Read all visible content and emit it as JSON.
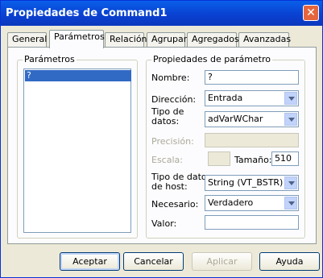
{
  "window": {
    "title": "Propiedades de Command1",
    "close_symbol": "✕"
  },
  "tabs": [
    {
      "label": "General"
    },
    {
      "label": "Parámetros"
    },
    {
      "label": "Relación"
    },
    {
      "label": "Agrupar"
    },
    {
      "label": "Agregados"
    },
    {
      "label": "Avanzadas"
    }
  ],
  "params_group": {
    "title": "Parámetros",
    "items": [
      "?"
    ]
  },
  "props_group": {
    "title": "Propiedades de parámetro"
  },
  "fields": {
    "nombre": {
      "label": "Nombre:",
      "value": "?"
    },
    "direccion": {
      "label": "Dirección:",
      "value": "Entrada"
    },
    "tipo_datos": {
      "label_line1": "Tipo de",
      "label_line2": "datos:",
      "value": "adVarWChar"
    },
    "precision": {
      "label": "Precisión:",
      "value": ""
    },
    "escala": {
      "label": "Escala:",
      "value": ""
    },
    "tamano": {
      "label": "Tamaño:",
      "value": "510"
    },
    "tipo_host": {
      "label_line1": "Tipo de datos",
      "label_line2": "de host:",
      "value": "String (VT_BSTR)"
    },
    "necesario": {
      "label": "Necesario:",
      "value": "Verdadero"
    },
    "valor": {
      "label": "Valor:",
      "value": ""
    }
  },
  "buttons": {
    "aceptar": "Aceptar",
    "cancelar": "Cancelar",
    "aplicar": "Aplicar",
    "ayuda": "Ayuda"
  }
}
